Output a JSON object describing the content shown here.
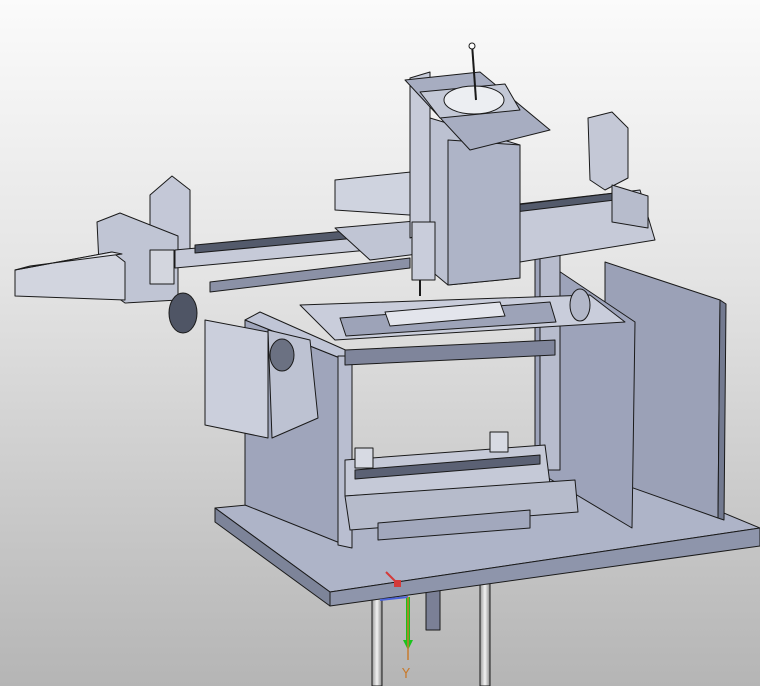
{
  "viewport": {
    "background_top": "#fbfbfb",
    "background_bottom": "#b5b5b5"
  },
  "model": {
    "body_color": "#aab0c4",
    "face_light": "#c3c8da",
    "face_dark": "#8c93aa",
    "edge_color": "#1a1a1a",
    "rail_color": "#5c6274",
    "rod_color": "#dcdcdc"
  },
  "triad": {
    "y_axis_label": "Y",
    "y_axis_color": "#c87a2c",
    "arrow_green": "#19c41c",
    "arrow_red": "#d43a3a",
    "arrow_blue": "#4a62d8"
  }
}
